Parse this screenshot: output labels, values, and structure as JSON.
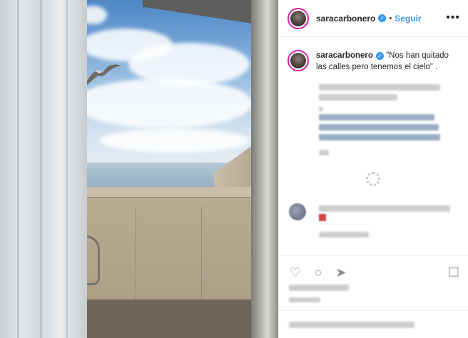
{
  "post": {
    "image_alt": "Seagull flying over the sea seen from a balcony window"
  },
  "header": {
    "username": "saracarbonero",
    "verified": "✓",
    "separator": "•",
    "follow_label": "Seguir",
    "more_icon": "•••"
  },
  "caption": {
    "username": "saracarbonero",
    "verified": "✓",
    "text": " \"Nos han quitado las calles pero tenemos el cielo\" ."
  },
  "icons": {
    "like": "♡",
    "comment": "○",
    "share": "➤",
    "save": "☐"
  },
  "colors": {
    "accent": "#3897f0",
    "text": "#262626",
    "border": "#efefef"
  }
}
